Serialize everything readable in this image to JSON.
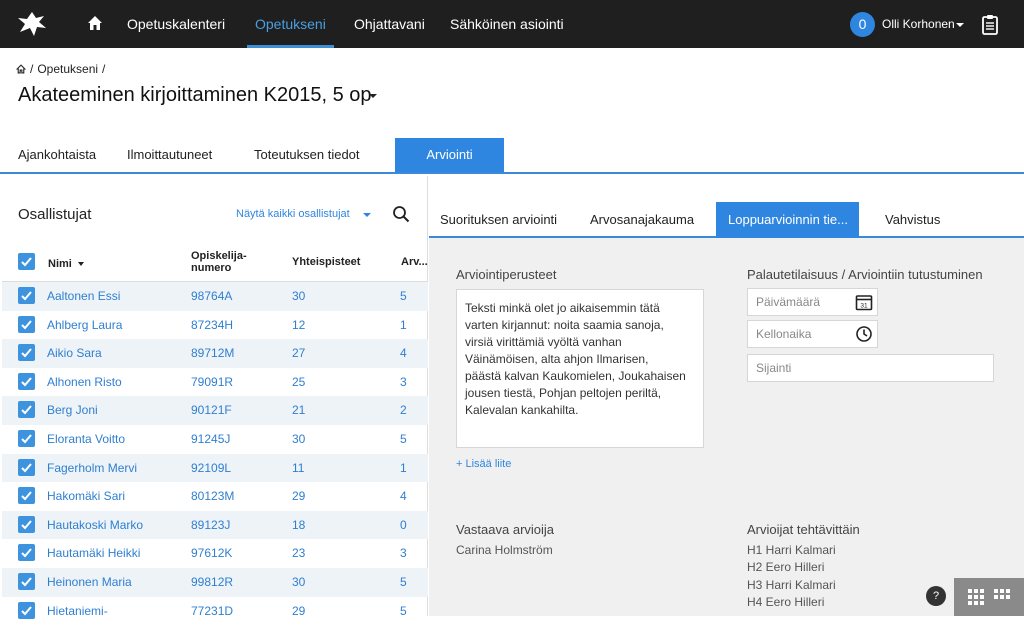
{
  "topnav": {
    "items": [
      {
        "label": "Opetuskalenteri",
        "active": false
      },
      {
        "label": "Opetukseni",
        "active": true
      },
      {
        "label": "Ohjattavani",
        "active": false
      },
      {
        "label": "Sähköinen asiointi",
        "active": false
      }
    ],
    "notification_count": "0",
    "user_name": "Olli Korhonen",
    "accent_color": "#2f86e0"
  },
  "breadcrumb": {
    "sep1": "/",
    "item": "Opetukseni",
    "sep2": "/"
  },
  "course": {
    "title": "Akateeminen kirjoittaminen K2015, 5 op"
  },
  "page_tabs": [
    {
      "label": "Ajankohtaista",
      "active": false
    },
    {
      "label": "Ilmoittautuneet",
      "active": false
    },
    {
      "label": "Toteutuksen tiedot",
      "active": false
    },
    {
      "label": "Arviointi",
      "active": true
    }
  ],
  "participants": {
    "title": "Osallistujat",
    "show_all": "Näytä kaikki osallistujat",
    "columns": {
      "name": "Nimi",
      "student_no_1": "Opiskelija-",
      "student_no_2": "numero",
      "points": "Yhteispisteet",
      "grade": "Arv..."
    },
    "rows": [
      {
        "name": "Aaltonen Essi",
        "id": "98764A",
        "points": "30",
        "grade": "5"
      },
      {
        "name": "Ahlberg Laura",
        "id": "87234H",
        "points": "12",
        "grade": "1"
      },
      {
        "name": "Aikio Sara",
        "id": "89712M",
        "points": "27",
        "grade": "4"
      },
      {
        "name": "Alhonen Risto",
        "id": "79091R",
        "points": "25",
        "grade": "3"
      },
      {
        "name": "Berg Joni",
        "id": "90121F",
        "points": "21",
        "grade": "2"
      },
      {
        "name": "Eloranta Voitto",
        "id": "91245J",
        "points": "30",
        "grade": "5"
      },
      {
        "name": "Fagerholm Mervi",
        "id": "92109L",
        "points": "11",
        "grade": "1"
      },
      {
        "name": "Hakomäki Sari",
        "id": "80123M",
        "points": "29",
        "grade": "4"
      },
      {
        "name": "Hautakoski Marko",
        "id": "89123J",
        "points": "18",
        "grade": "0"
      },
      {
        "name": "Hautamäki Heikki",
        "id": "97612K",
        "points": "23",
        "grade": "3"
      },
      {
        "name": "Heinonen Maria",
        "id": "99812R",
        "points": "30",
        "grade": "5"
      },
      {
        "name": "Hietaniemi-",
        "id": "77231D",
        "points": "29",
        "grade": "5"
      }
    ]
  },
  "assessment_tabs": [
    {
      "label": "Suorituksen arviointi",
      "active": false
    },
    {
      "label": "Arvosanajakauma",
      "active": false
    },
    {
      "label": "Loppuarvioinnin tie...",
      "active": true
    },
    {
      "label": "Vahvistus",
      "active": false
    }
  ],
  "criteria": {
    "label": "Arviointiperusteet",
    "lines": [
      "Teksti minkä olet jo aikaisemmin tätä",
      "varten kirjannut: noita saamia sanoja,",
      "virsiä virittämiä vyöltä vanhan",
      "Väinämöisen, alta ahjon Ilmarisen,",
      "päästä kalvan Kaukomielen, Joukahaisen",
      "jousen tiestä, Pohjan peltojen periltä,",
      "Kalevalan kankahilta."
    ],
    "add_attachment": "+ Lisää liite"
  },
  "feedback": {
    "label": "Palautetilaisuus / Arviointiin tutustuminen",
    "date_placeholder": "Päivämäärä",
    "date_icon_text": "31",
    "time_placeholder": "Kellonaika",
    "location_placeholder": "Sijainti"
  },
  "responsible": {
    "label": "Vastaava arvioija",
    "name": "Carina Holmström"
  },
  "task_assessors": {
    "label": "Arvioijat tehtävittäin",
    "items": [
      "H1  Harri Kalmari",
      "H2  Eero Hilleri",
      "H3  Harri Kalmari",
      "H4  Eero Hilleri"
    ]
  },
  "help": "?"
}
